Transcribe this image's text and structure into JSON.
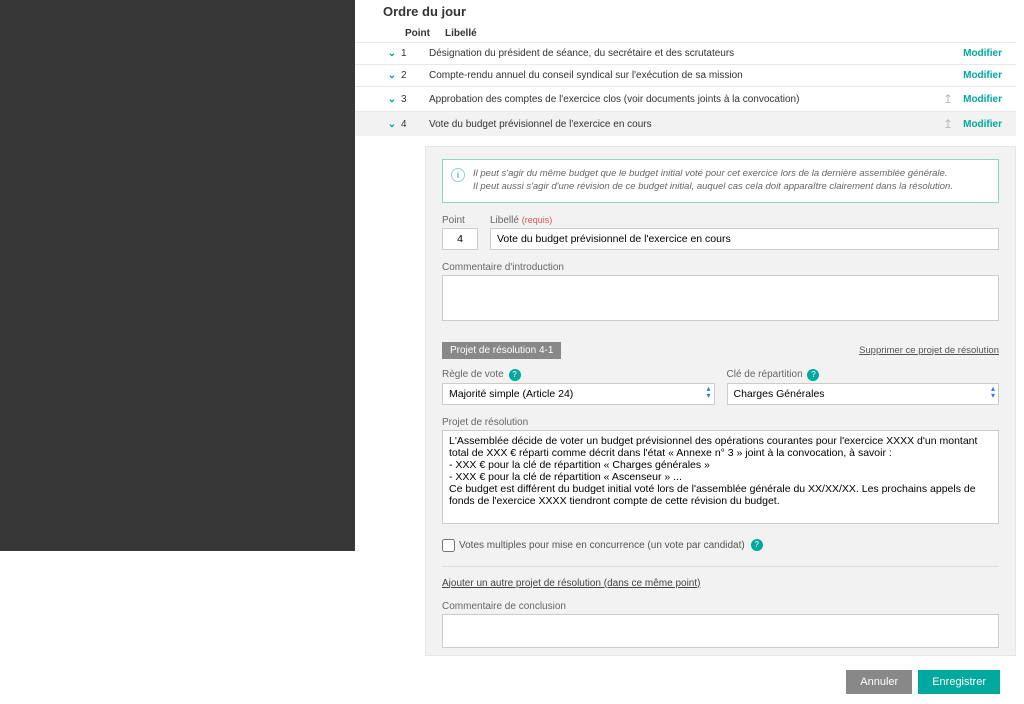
{
  "page_title": "Ordre du jour",
  "agenda_header": {
    "point": "Point",
    "label": "Libellé"
  },
  "modifier_label": "Modifier",
  "agenda_items": [
    {
      "num": "1",
      "label": "Désignation du président de séance, du secrétaire et des scrutateurs",
      "has_up": false
    },
    {
      "num": "2",
      "label": "Compte-rendu annuel du conseil syndical sur l'exécution de sa mission",
      "has_up": false
    },
    {
      "num": "3",
      "label": "Approbation des comptes de l'exercice clos (voir documents joints à la convocation)",
      "has_up": true
    },
    {
      "num": "4",
      "label": "Vote du budget prévisionnel de l'exercice en cours",
      "has_up": true
    }
  ],
  "info_text1": "Il peut s'agir du même budget que le budget initial voté pour cet exercice lors de la dernière assemblée générale.",
  "info_text2": "Il peut aussi s'agir d'une révision de ce budget initial, auquel cas cela doit apparaître clairement dans la résolution.",
  "form": {
    "point_label": "Point",
    "point_value": "4",
    "libelle_label": "Libellé",
    "required": "(requis)",
    "libelle_value": "Vote du budget prévisionnel de l'exercice en cours",
    "intro_label": "Commentaire d'introduction",
    "intro_value": ""
  },
  "resolution": {
    "badge": "Projet de résolution 4-1",
    "delete": "Supprimer ce projet de résolution",
    "regle_label": "Règle de vote",
    "regle_value": "Majorité simple (Article 24)",
    "cle_label": "Clé de répartition",
    "cle_value": "Charges Générales",
    "projet_label": "Projet de résolution",
    "projet_value": "L'Assemblée décide de voter un budget prévisionnel des opérations courantes pour l'exercice XXXX d'un montant total de XXX € réparti comme décrit dans l'état « Annexe n° 3 » joint à la convocation, à savoir :\n- XXX € pour la clé de répartition « Charges générales »\n- XXX € pour la clé de répartition « Ascenseur » ...\nCe budget est différent du budget initial voté lors de l'assemblée générale du XX/XX/XX. Les prochains appels de fonds de l'exercice XXXX tiendront compte de cette révision du budget.",
    "votes_multiples": "Votes multiples pour mise en concurrence (un vote par candidat)"
  },
  "add_resolution": "Ajouter un autre projet de résolution (dans ce même point)",
  "conclusion_label": "Commentaire de conclusion",
  "conclusion_value": "",
  "buttons": {
    "cancel": "Annuler",
    "save": "Enregistrer"
  }
}
